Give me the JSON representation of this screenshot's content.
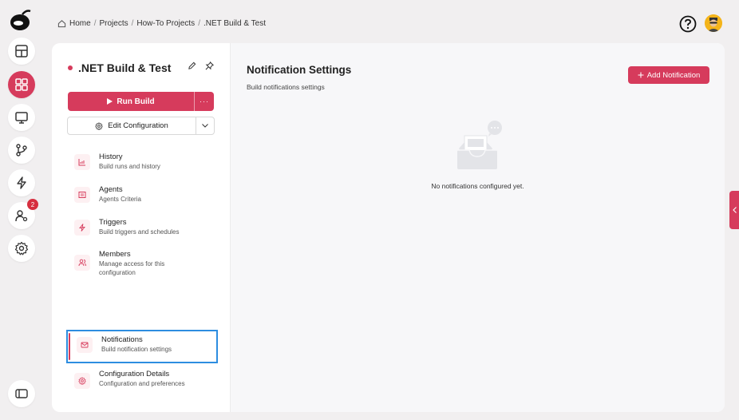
{
  "breadcrumb": {
    "items": [
      "Home",
      "Projects",
      "How-To Projects",
      ".NET Build & Test"
    ],
    "separator": "/"
  },
  "rail": {
    "items": [
      {
        "icon": "grid-icon",
        "active": false
      },
      {
        "icon": "dashboard-icon",
        "active": true
      },
      {
        "icon": "monitor-icon",
        "active": false
      },
      {
        "icon": "git-branch-icon",
        "active": false
      },
      {
        "icon": "lightning-icon",
        "active": false
      },
      {
        "icon": "user-settings-icon",
        "active": false,
        "badge": "2"
      },
      {
        "icon": "gear-icon",
        "active": false
      }
    ]
  },
  "project": {
    "title": ".NET Build & Test",
    "run_label": "Run Build",
    "run_more": "···",
    "edit_label": "Edit Configuration"
  },
  "nav": {
    "items": [
      {
        "label": "History",
        "sub": "Build runs and history",
        "icon": "chart-icon"
      },
      {
        "label": "Agents",
        "sub": "Agents Criteria",
        "icon": "agent-icon"
      },
      {
        "label": "Triggers",
        "sub": "Build triggers and schedules",
        "icon": "lightning-icon"
      },
      {
        "label": "Members",
        "sub": "Manage access for this configuration",
        "icon": "members-icon"
      },
      {
        "label": "Notifications",
        "sub": "Build notification settings",
        "icon": "mail-icon",
        "selected": true
      },
      {
        "label": "Configuration Details",
        "sub": "Configuration and preferences",
        "icon": "gear-icon"
      }
    ]
  },
  "content": {
    "title": "Notification Settings",
    "subtitle": "Build notifications settings",
    "add_label": "Add Notification",
    "empty_text": "No notifications configured yet."
  },
  "colors": {
    "accent": "#d63b5c",
    "selection_border": "#2d8de0",
    "background": "#f1eff0"
  }
}
